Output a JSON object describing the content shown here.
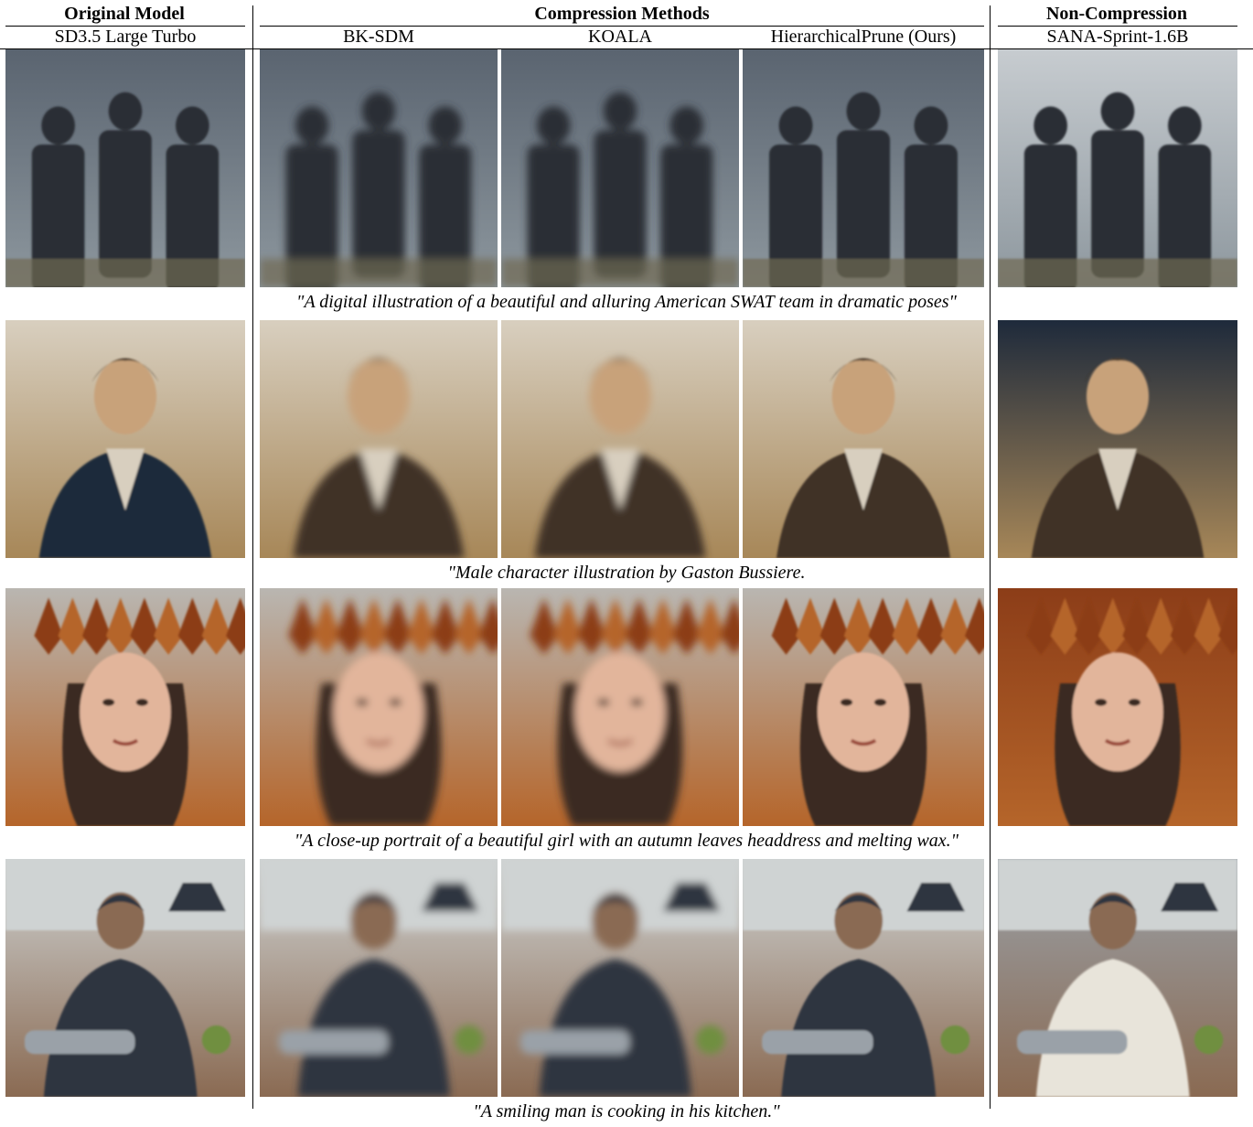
{
  "groups": {
    "original": "Original Model",
    "compression": "Compression Methods",
    "non_compression": "Non-Compression"
  },
  "columns": [
    "SD3.5 Large Turbo",
    "BK-SDM",
    "KOALA",
    "HierarchicalPrune (Ours)",
    "SANA-Sprint-1.6B"
  ],
  "rows": [
    {
      "caption": "\"A digital illustration of a beautiful and alluring American SWAT team in dramatic poses\"",
      "subject": "swat-team",
      "palette": [
        "#5a6470",
        "#8d979e",
        "#2a2f35",
        "#6f6a52",
        "#c7ccd0"
      ]
    },
    {
      "caption": "\"Male character illustration by Gaston Bussiere.",
      "subject": "male-portrait",
      "palette": [
        "#d8cfbf",
        "#a78758",
        "#3f3325",
        "#c8a27a",
        "#1e2a3b"
      ]
    },
    {
      "caption": "\"A close-up portrait of a beautiful girl with an autumn leaves headdress and melting wax.\"",
      "subject": "autumn-portrait",
      "palette": [
        "#b9b6b1",
        "#b5652a",
        "#e2b59b",
        "#3b2a22",
        "#8c3d18"
      ]
    },
    {
      "caption": "\"A smiling man is cooking in his kitchen.\"",
      "subject": "man-cooking",
      "palette": [
        "#cfd3d3",
        "#8a6a52",
        "#2e3440",
        "#6f8f3f",
        "#9aa1a8"
      ]
    }
  ]
}
